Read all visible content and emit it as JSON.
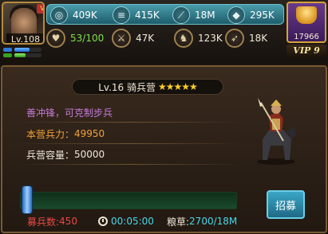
{
  "player": {
    "level": "Lv.108",
    "vip_badge": "V"
  },
  "resources_top": [
    {
      "icon": "silver-coin-icon",
      "value": "409K"
    },
    {
      "icon": "wood-logs-icon",
      "value": "415K"
    },
    {
      "icon": "grain-icon",
      "value": "18M"
    },
    {
      "icon": "iron-ore-icon",
      "value": "295K"
    }
  ],
  "resources_bottom": [
    {
      "icon": "heart-icon",
      "value": "53/100"
    },
    {
      "icon": "sword-icon",
      "value": "47K"
    },
    {
      "icon": "horse-icon",
      "value": "123K"
    },
    {
      "icon": "bow-icon",
      "value": "18K"
    }
  ],
  "gold": {
    "value": "17966"
  },
  "vip": {
    "label": "VIP 9"
  },
  "building": {
    "title": "Lv.16 骑兵营",
    "stars": "★★★★★",
    "description": "善冲锋，可克制步兵",
    "troops_label": "本营兵力：",
    "troops_value": "49950",
    "capacity_label": "兵营容量：",
    "capacity_value": "50000"
  },
  "recruit": {
    "button_label": "招募",
    "count_label": "募兵数:",
    "count_value": "450",
    "time": "00:05:00",
    "food_label": "粮草:",
    "food_value": "2700/18M",
    "slider_level": 0
  },
  "colors": {
    "accent_orange": "#f0a23a",
    "accent_purple": "#c47ad8",
    "recruit_red": "#e84848",
    "timer_cyan": "#4ad6e8"
  }
}
